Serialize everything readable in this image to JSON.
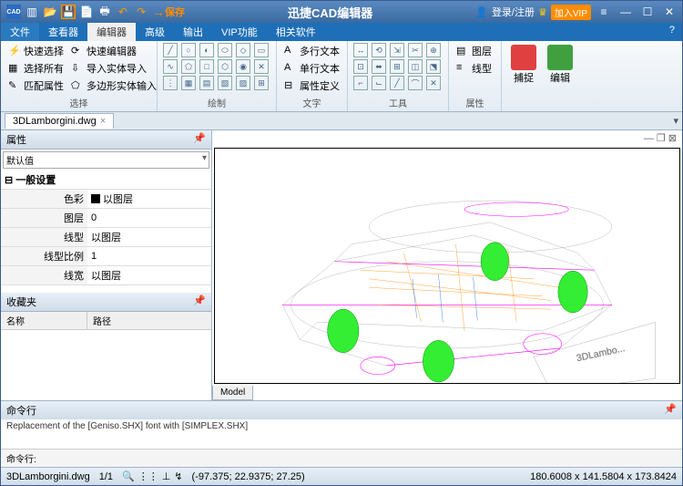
{
  "titlebar": {
    "annotation": "保存",
    "title": "迅捷CAD编辑器",
    "login": "登录/注册",
    "vip": "加入VIP"
  },
  "menu": {
    "tabs": [
      "文件",
      "查看器",
      "编辑器",
      "高级",
      "输出",
      "VIP功能",
      "相关软件"
    ],
    "active": 2
  },
  "ribbon": {
    "groups": [
      {
        "label": "选择",
        "items": [
          "快速选择",
          "选择所有",
          "匹配属性",
          "快速编辑器",
          "导入实体导入",
          "多边形实体输入"
        ]
      },
      {
        "label": "绘制"
      },
      {
        "label": "文字",
        "items": [
          "多行文本",
          "单行文本",
          "属性定义"
        ]
      },
      {
        "label": "工具"
      },
      {
        "label": "属性",
        "items": [
          "图层",
          "线型"
        ]
      },
      {
        "label": "",
        "big": [
          "捕捉",
          "编辑"
        ]
      }
    ]
  },
  "doctab": {
    "name": "3DLamborgini.dwg"
  },
  "panels": {
    "props": {
      "title": "属性",
      "default": "默认值",
      "section": "一般设置",
      "rows": [
        {
          "k": "色彩",
          "v": "以图层",
          "sw": true
        },
        {
          "k": "图层",
          "v": "0"
        },
        {
          "k": "线型",
          "v": "以图层"
        },
        {
          "k": "线型比例",
          "v": "1"
        },
        {
          "k": "线宽",
          "v": "以图层"
        }
      ]
    },
    "fav": {
      "title": "收藏夹",
      "cols": [
        "名称",
        "路径"
      ]
    }
  },
  "viewport": {
    "model_tab": "Model"
  },
  "cmd": {
    "title": "命令行",
    "output": "Replacement of the [Geniso.SHX] font with [SIMPLEX.SHX]",
    "prompt": "命令行:"
  },
  "status": {
    "file": "3DLamborgini.dwg",
    "page": "1/1",
    "coords": "(-97.375; 22.9375; 27.25)",
    "dims": "180.6008 x 141.5804 x 173.8424"
  }
}
